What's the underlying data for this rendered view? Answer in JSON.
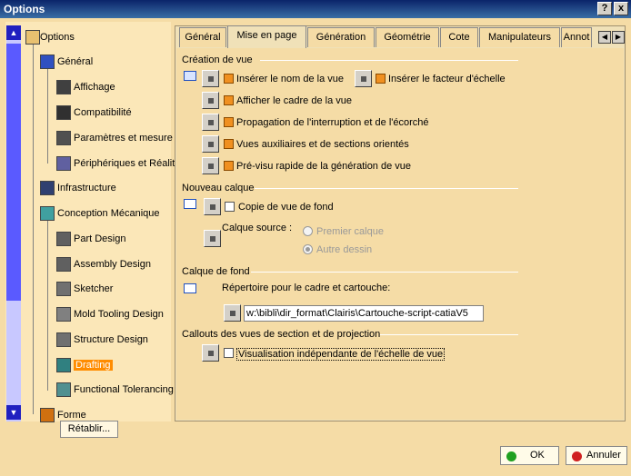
{
  "window": {
    "title": "Options",
    "help_btn": "?",
    "close_btn": "x"
  },
  "tree": {
    "root": "Options",
    "items": [
      {
        "label": "Général",
        "icon": "general-icon"
      },
      {
        "label": "Affichage",
        "icon": "display-icon"
      },
      {
        "label": "Compatibilité",
        "icon": "compatibility-icon"
      },
      {
        "label": "Paramètres et mesure",
        "icon": "parameters-icon"
      },
      {
        "label": "Périphériques et Réalit",
        "icon": "devices-icon"
      },
      {
        "label": "Infrastructure",
        "icon": "infrastructure-icon"
      },
      {
        "label": "Conception Mécanique",
        "icon": "mechanical-icon"
      },
      {
        "label": "Part Design",
        "icon": "part-design-icon"
      },
      {
        "label": "Assembly Design",
        "icon": "assembly-icon"
      },
      {
        "label": "Sketcher",
        "icon": "sketcher-icon"
      },
      {
        "label": "Mold Tooling Design",
        "icon": "mold-icon"
      },
      {
        "label": "Structure Design",
        "icon": "structure-icon"
      },
      {
        "label": "Drafting",
        "icon": "drafting-icon",
        "selected": true
      },
      {
        "label": "Functional Tolerancing",
        "icon": "tolerancing-icon"
      },
      {
        "label": "Forme",
        "icon": "shape-icon"
      }
    ],
    "restore_label": "Rétablir..."
  },
  "tabs": [
    "Général",
    "Mise en page",
    "Génération",
    "Géométrie",
    "Cote",
    "Manipulateurs",
    "Annot"
  ],
  "active_tab": "Mise en page",
  "sections": {
    "creation": {
      "title": "Création de vue",
      "opt1": "Insérer le nom de la vue",
      "opt2": "Insérer le  facteur d'échelle",
      "opt3": "Afficher le cadre de la vue",
      "opt4": "Propagation de l'interruption et de l'écorché",
      "opt5": "Vues auxiliaires et de sections orientés",
      "opt6": "Pré-visu rapide de la génération de vue"
    },
    "calque": {
      "title": "Nouveau calque",
      "copy": "Copie de vue de fond",
      "source": "Calque source :",
      "r1": "Premier calque",
      "r2": "Autre dessin"
    },
    "fond": {
      "title": "Calque de fond",
      "dir_label": "Répertoire pour le cadre et cartouche:",
      "dir_value": "w:\\bibli\\dir_format\\Clairis\\Cartouche-script-catiaV5"
    },
    "callouts": {
      "title": "Callouts des vues de section et de projection",
      "vis": "Visualisation indépendante de l'échelle de vue"
    }
  },
  "buttons": {
    "ok": "OK",
    "cancel": "Annuler"
  },
  "colors": {
    "checked": "#f09020",
    "selected_tree": "#ff8c00",
    "ok_dot": "#20a020",
    "cancel_dot": "#d02020"
  }
}
